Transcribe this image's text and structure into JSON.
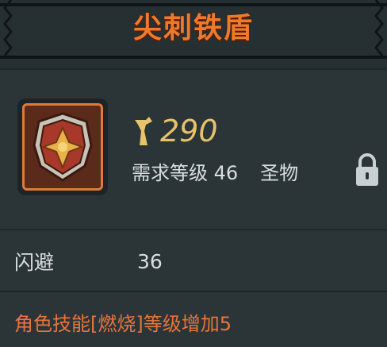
{
  "item": {
    "name": "尖刺铁盾",
    "price": "290",
    "level_requirement": "需求等级 46",
    "type": "圣物",
    "icon": "spiked-iron-shield-icon",
    "price_icon": "anvil-currency-icon",
    "lock_icon": "lock-icon"
  },
  "stats": [
    {
      "name": "闪避",
      "value": "36"
    }
  ],
  "effect": "角色技能[燃烧]等级增加5",
  "colors": {
    "title": "#f07a2a",
    "price": "#e6c36a",
    "effect": "#e8743a",
    "background": "#2b3538"
  }
}
